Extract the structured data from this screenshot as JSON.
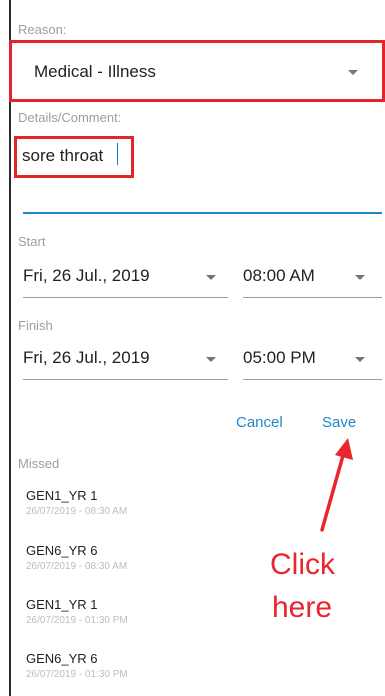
{
  "reason": {
    "label": "Reason:",
    "value": "Medical - Illness"
  },
  "details": {
    "label": "Details/Comment:",
    "value": "sore throat"
  },
  "start": {
    "label": "Start",
    "date": "Fri, 26 Jul., 2019",
    "time": "08:00 AM"
  },
  "finish": {
    "label": "Finish",
    "date": "Fri, 26 Jul., 2019",
    "time": "05:00 PM"
  },
  "actions": {
    "cancel_label": "Cancel",
    "save_label": "Save"
  },
  "missed": {
    "label": "Missed",
    "items": [
      {
        "course": "GEN1_YR 1",
        "timestamp": "26/07/2019 - 08:30 AM"
      },
      {
        "course": "GEN6_YR 6",
        "timestamp": "26/07/2019 - 08:30 AM"
      },
      {
        "course": "GEN1_YR 1",
        "timestamp": "26/07/2019 - 01:30 PM"
      },
      {
        "course": "GEN6_YR 6",
        "timestamp": "26/07/2019 - 01:30 PM"
      }
    ]
  },
  "annotation": {
    "line1": "Click",
    "line2": "here"
  },
  "colors": {
    "highlight_box": "#e0262b",
    "accent": "#1e88c8",
    "callout": "#e8262b"
  }
}
